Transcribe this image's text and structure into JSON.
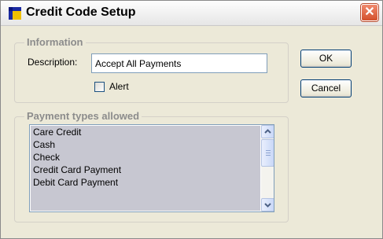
{
  "window": {
    "title": "Credit Code Setup",
    "close_glyph": "✕",
    "app_icon": "app-window-icon"
  },
  "information": {
    "legend": "Information",
    "description_label": "Description:",
    "description_value": "Accept All Payments",
    "alert_label": "Alert",
    "alert_checked": false
  },
  "buttons": {
    "ok_label": "OK",
    "cancel_label": "Cancel"
  },
  "payment_types": {
    "legend": "Payment types allowed",
    "items": [
      "Care Credit",
      "Cash",
      "Check",
      "Credit Card Payment",
      "Debit Card Payment"
    ]
  },
  "colors": {
    "selection": "#c7c7d1",
    "close_button": "#d3502c",
    "group_legend": "#8c8c8c"
  }
}
